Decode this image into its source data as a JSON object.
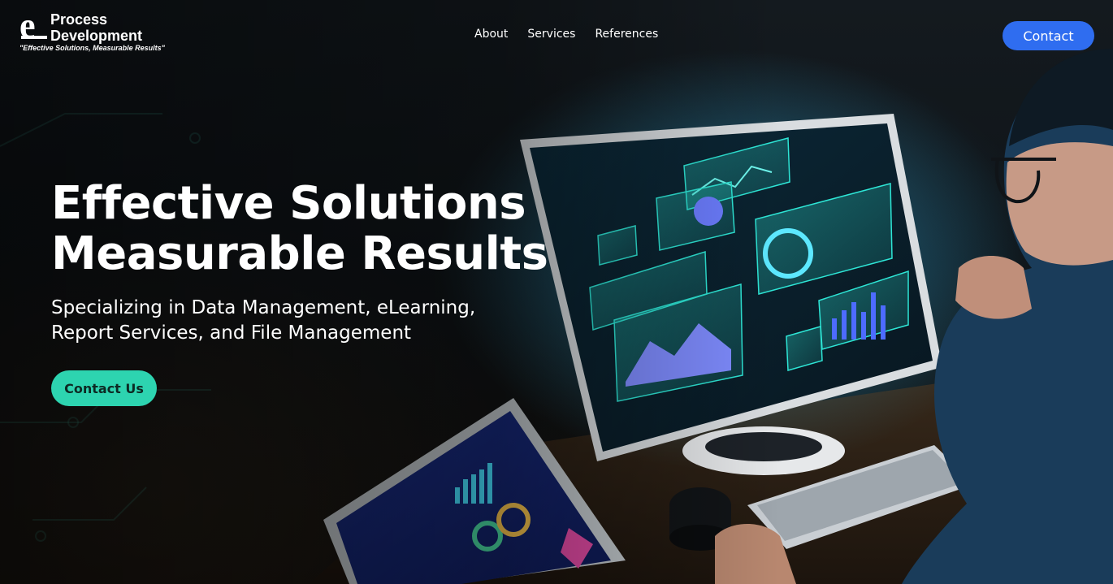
{
  "brand": {
    "logo_letter": "e",
    "name_line1": "Process",
    "name_line2": "Development",
    "tagline": "\"Effective Solutions, Measurable Results\""
  },
  "nav": {
    "items": [
      {
        "label": "About"
      },
      {
        "label": "Services"
      },
      {
        "label": "References"
      }
    ],
    "contact_label": "Contact"
  },
  "hero": {
    "title_line1": "Effective Solutions",
    "title_line2": "Measurable Results",
    "subtitle_line1": "Specializing in Data Management, eLearning,",
    "subtitle_line2": "Report Services, and File Management",
    "cta_label": "Contact Us"
  },
  "colors": {
    "contact_button": "#2f6df0",
    "cta_button": "#2dd4b0",
    "hologram": "#2ee6d6"
  }
}
